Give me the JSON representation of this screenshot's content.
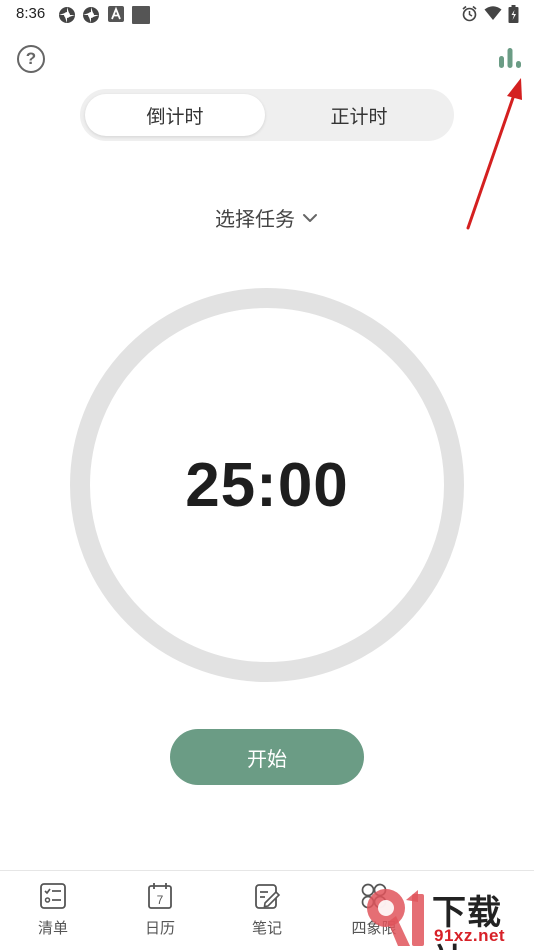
{
  "status_bar": {
    "time": "8:36"
  },
  "header": {
    "help_icon": "help-circle-icon",
    "stats_icon": "bar-chart-icon"
  },
  "mode": {
    "countdown": "倒计时",
    "countup": "正计时",
    "active": "countdown"
  },
  "task": {
    "label": "选择任务"
  },
  "timer": {
    "display": "25:00"
  },
  "start_button": {
    "label": "开始"
  },
  "nav": {
    "items": [
      {
        "label": "清单",
        "icon": "checklist-icon"
      },
      {
        "label": "日历",
        "icon": "calendar-icon"
      },
      {
        "label": "笔记",
        "icon": "note-edit-icon"
      },
      {
        "label": "四象限",
        "icon": "four-quadrant-icon"
      }
    ]
  },
  "calendar_icon_day": "7",
  "watermark": {
    "title": "下载站",
    "url": "91xz.net"
  },
  "colors": {
    "accent": "#6b9c85",
    "ring": "#e2e2e2",
    "arrow": "#d42020"
  }
}
